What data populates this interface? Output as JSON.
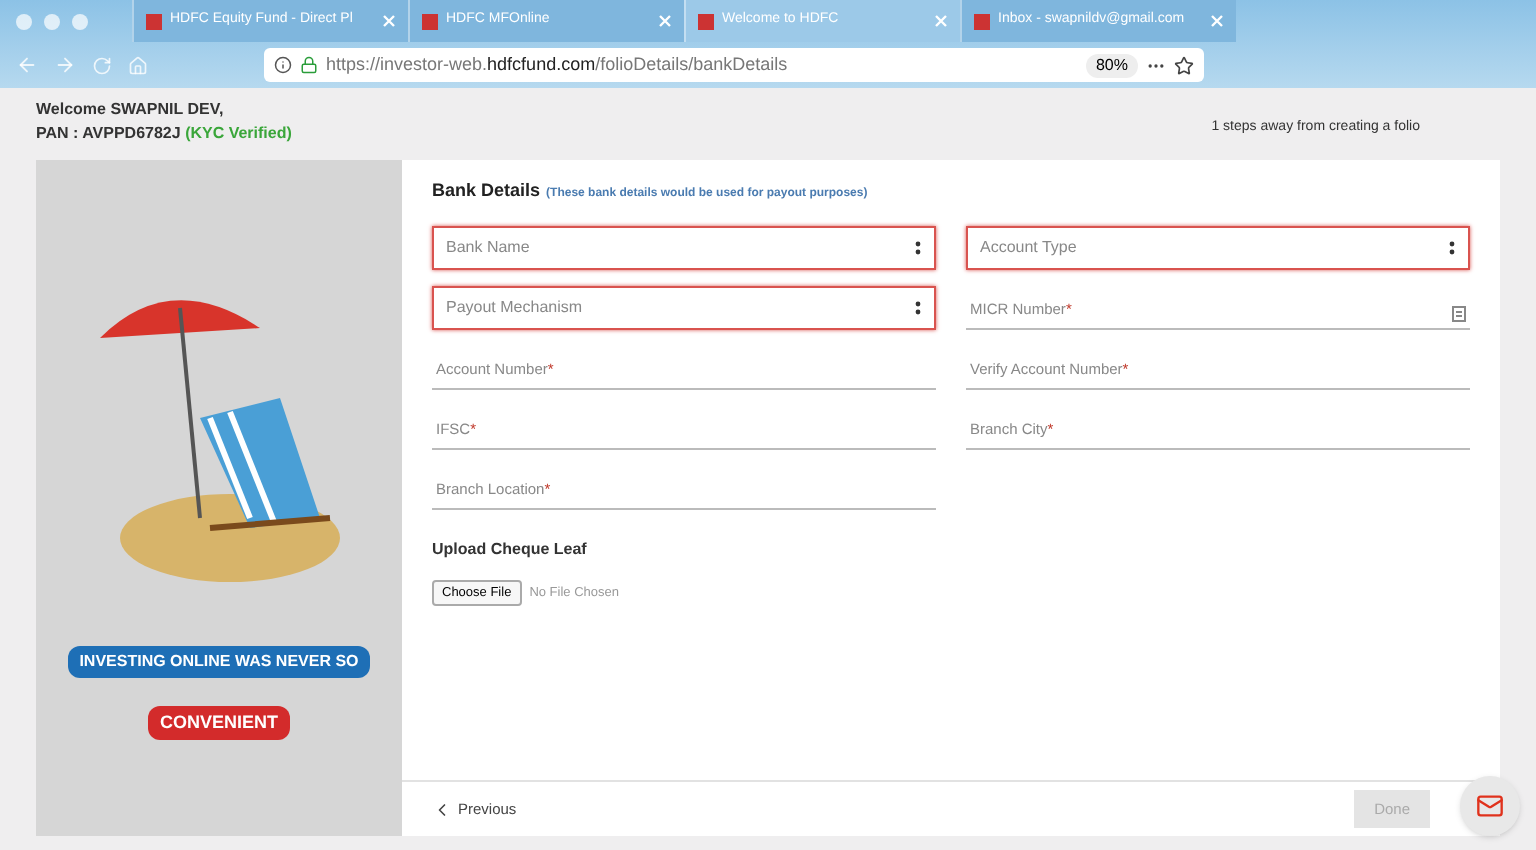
{
  "browser": {
    "tabs": [
      {
        "title": "HDFC Equity Fund - Direct Pl",
        "selected": false
      },
      {
        "title": "HDFC MFOnline",
        "selected": false
      },
      {
        "title": "Welcome to HDFC",
        "selected": true
      },
      {
        "title": "Inbox - swapnildv@gmail.com",
        "selected": false
      }
    ],
    "url_prefix": "https://investor-web.",
    "url_domain": "hdfcfund.com",
    "url_path": "/folioDetails/bankDetails",
    "zoom": "80%"
  },
  "header": {
    "welcome": "Welcome SWAPNIL DEV,",
    "pan": "PAN : AVPPD6782J",
    "kyc": "(KYC Verified)",
    "steps": "1 steps away from creating a folio"
  },
  "banner": {
    "line1": "INVESTING ONLINE WAS NEVER SO",
    "line2": "CONVENIENT"
  },
  "form": {
    "title": "Bank Details",
    "subtitle": "(These bank details would be used for payout purposes)",
    "fields": [
      {
        "kind": "select",
        "label": "Bank Name",
        "error": true
      },
      {
        "kind": "select",
        "label": "Account Type",
        "error": true
      },
      {
        "kind": "select",
        "label": "Payout Mechanism",
        "error": true
      },
      {
        "kind": "text",
        "label": "MICR Number",
        "mark": "*",
        "error": false,
        "icon": true
      },
      {
        "kind": "text",
        "label": "Account Number",
        "mark": "*",
        "error": false,
        "icon": false
      },
      {
        "kind": "text",
        "label": "Verify Account Number",
        "mark": "*",
        "error": false,
        "icon": false
      },
      {
        "kind": "text",
        "label": "IFSC",
        "mark": "*",
        "error": false,
        "icon": false
      },
      {
        "kind": "text",
        "label": "Branch City",
        "mark": "*",
        "error": false,
        "icon": false
      },
      {
        "kind": "text",
        "label": "Branch Location",
        "mark": "*",
        "error": false,
        "icon": false
      }
    ],
    "upload_title": "Upload Cheque Leaf",
    "choose_file": "Choose File",
    "no_file": "No File Chosen",
    "previous": "Previous",
    "done": "Done",
    "done_disabled": true
  }
}
